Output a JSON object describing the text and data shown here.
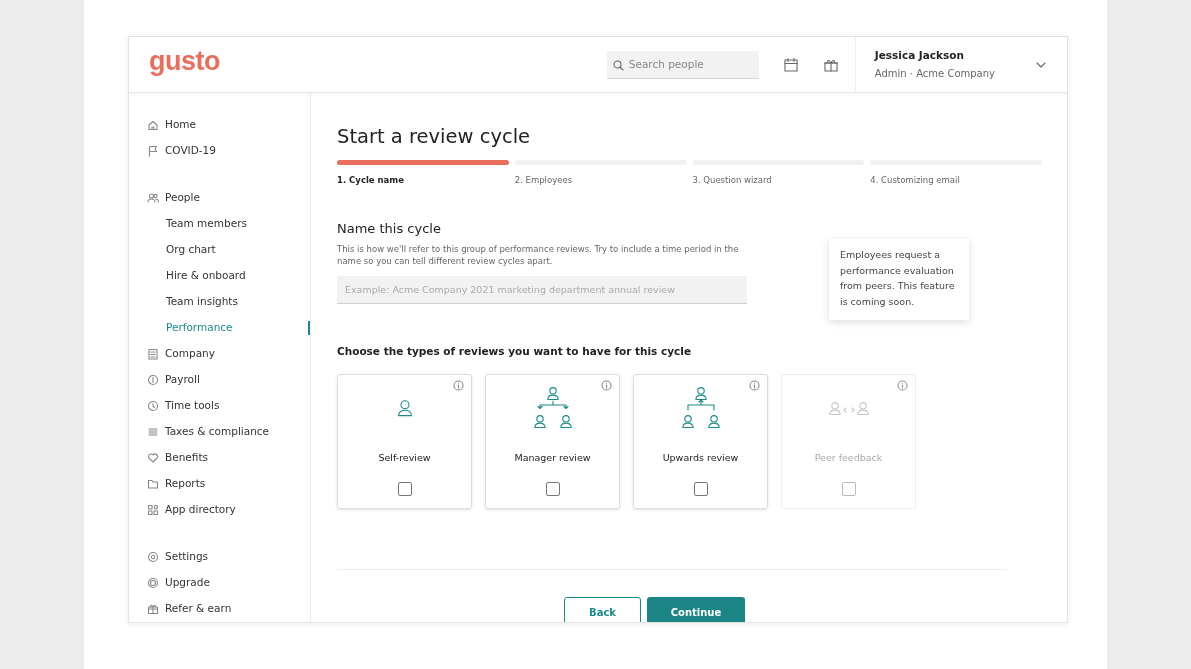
{
  "header": {
    "logo": "gusto",
    "search": {
      "placeholder": "Search people"
    },
    "user": {
      "name": "Jessica Jackson",
      "role": "Admin · Acme Company"
    }
  },
  "sidebar": {
    "groups": [
      {
        "items": [
          {
            "label": "Home",
            "kind": "home",
            "selected": false
          },
          {
            "label": "COVID-19",
            "kind": "flag",
            "selected": false
          }
        ]
      },
      {
        "items": [
          {
            "label": "People",
            "kind": "people",
            "selected": false,
            "children": [
              {
                "label": "Team members",
                "selected": false
              },
              {
                "label": "Org chart",
                "selected": false
              },
              {
                "label": "Hire & onboard",
                "selected": false
              },
              {
                "label": "Team insights",
                "selected": false
              },
              {
                "label": "Performance",
                "selected": true
              }
            ]
          },
          {
            "label": "Company",
            "kind": "building",
            "selected": false
          },
          {
            "label": "Payroll",
            "kind": "coin",
            "selected": false
          },
          {
            "label": "Time tools",
            "kind": "clock",
            "selected": false
          },
          {
            "label": "Taxes & compliance",
            "kind": "lines",
            "selected": false
          },
          {
            "label": "Benefits",
            "kind": "heart",
            "selected": false
          },
          {
            "label": "Reports",
            "kind": "folder",
            "selected": false
          },
          {
            "label": "App directory",
            "kind": "apps",
            "selected": false
          }
        ]
      },
      {
        "items": [
          {
            "label": "Settings",
            "kind": "gear",
            "selected": false
          },
          {
            "label": "Upgrade",
            "kind": "badge",
            "selected": false
          },
          {
            "label": "Refer & earn",
            "kind": "gift",
            "selected": false
          }
        ]
      }
    ]
  },
  "page": {
    "title": "Start a review cycle",
    "steps": [
      {
        "label": "1. Cycle name",
        "selected": true
      },
      {
        "label": "2. Employees",
        "selected": false
      },
      {
        "label": "3. Question wizard",
        "selected": false
      },
      {
        "label": "4. Customizing email",
        "selected": false
      }
    ],
    "name_section": {
      "heading": "Name this cycle",
      "description": "This is how we'll refer to this group of performance reviews. Try to include a time period in the name so you can tell different review cycles apart.",
      "placeholder": "Example: Acme Company 2021 marketing department annual review"
    },
    "types_heading": "Choose the types of reviews you want to have for this cycle",
    "review_types": [
      {
        "kind": "self",
        "label": "Self-review",
        "checked": false,
        "disabled": false
      },
      {
        "kind": "manager",
        "label": "Manager review",
        "checked": false,
        "disabled": false
      },
      {
        "kind": "upwards",
        "label": "Upwards review",
        "checked": false,
        "disabled": false
      },
      {
        "kind": "peer",
        "label": "Peer feedback",
        "checked": false,
        "disabled": true
      }
    ],
    "tooltip": "Employees request a performance evaluation from peers. This feature is coming soon.",
    "buttons": {
      "back": "Back",
      "continue": "Continue"
    }
  }
}
